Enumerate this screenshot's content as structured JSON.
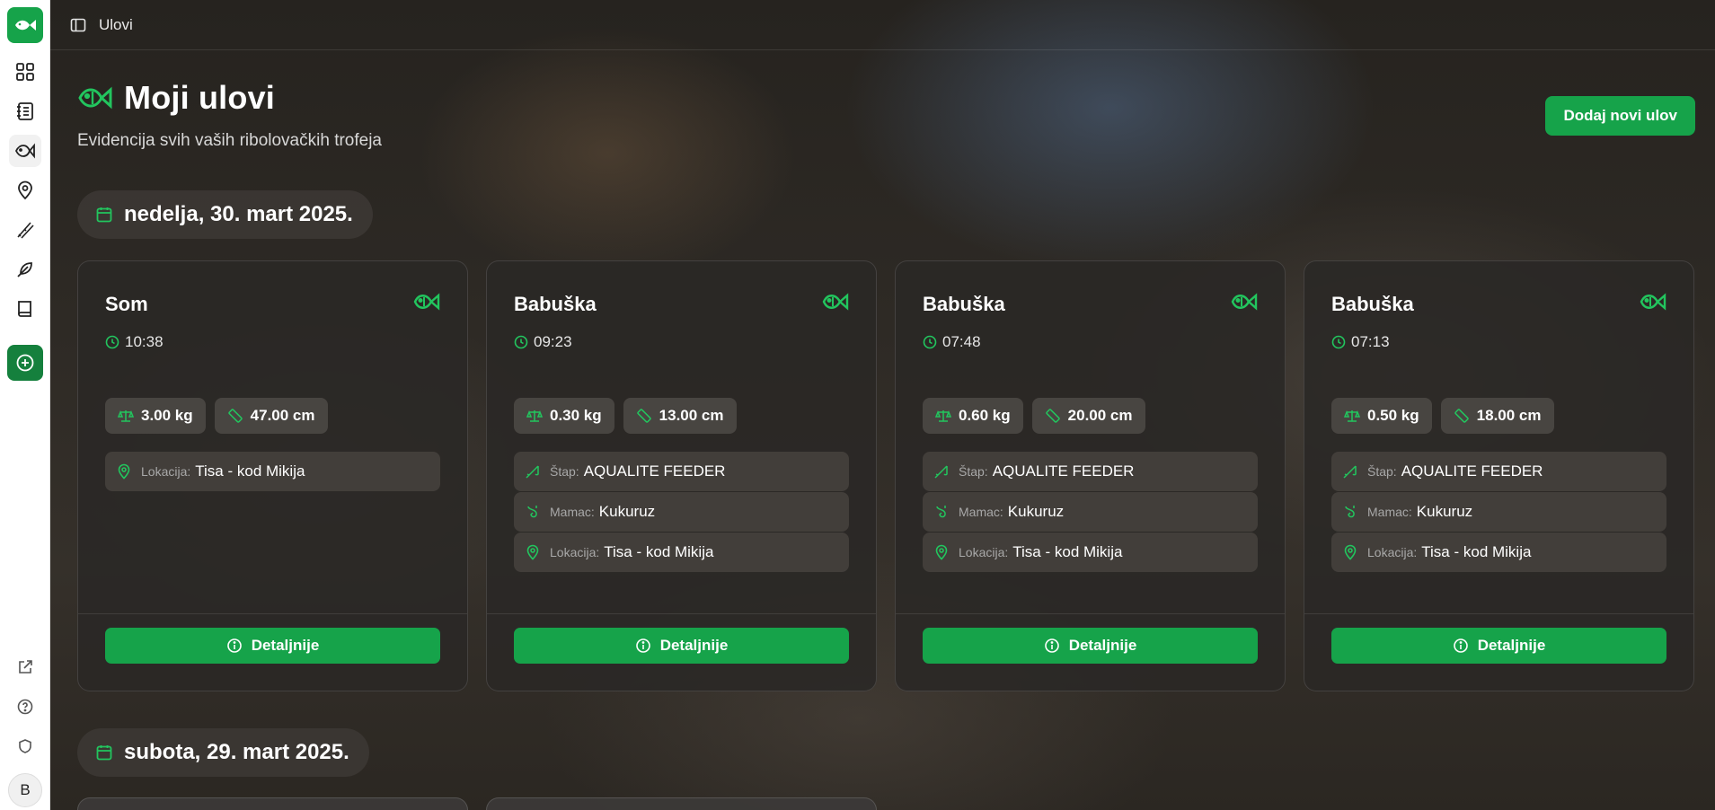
{
  "app": {
    "title": "Ulovi"
  },
  "sidebar": {
    "items": [
      {
        "name": "dashboard",
        "icon": "grid-icon"
      },
      {
        "name": "journal",
        "icon": "notebook-icon"
      },
      {
        "name": "catches",
        "icon": "fish-icon",
        "active": true
      },
      {
        "name": "locations",
        "icon": "map-pin-icon"
      },
      {
        "name": "rods",
        "icon": "fishing-rods-icon"
      },
      {
        "name": "baits",
        "icon": "feather-icon"
      },
      {
        "name": "guide",
        "icon": "book-icon"
      }
    ],
    "add_icon": "plus-circle-icon",
    "bottom": [
      {
        "name": "external",
        "icon": "external-link-icon"
      },
      {
        "name": "help",
        "icon": "help-circle-icon"
      },
      {
        "name": "privacy",
        "icon": "shield-icon"
      }
    ],
    "avatar_initial": "B"
  },
  "header": {
    "page_title": "Moji ulovi",
    "subtitle": "Evidencija svih vaših ribolovačkih trofeja",
    "add_button": "Dodaj novi ulov"
  },
  "groups": [
    {
      "date": "nedelja, 30. mart 2025.",
      "catches": [
        {
          "fish": "Som",
          "time": "10:38",
          "weight": "3.00 kg",
          "length": "47.00 cm",
          "rod": null,
          "bait": null,
          "location": "Tisa - kod Mikija"
        },
        {
          "fish": "Babuška",
          "time": "09:23",
          "weight": "0.30 kg",
          "length": "13.00 cm",
          "rod": "AQUALITE FEEDER",
          "bait": "Kukuruz",
          "location": "Tisa - kod Mikija"
        },
        {
          "fish": "Babuška",
          "time": "07:48",
          "weight": "0.60 kg",
          "length": "20.00 cm",
          "rod": "AQUALITE FEEDER",
          "bait": "Kukuruz",
          "location": "Tisa - kod Mikija"
        },
        {
          "fish": "Babuška",
          "time": "07:13",
          "weight": "0.50 kg",
          "length": "18.00 cm",
          "rod": "AQUALITE FEEDER",
          "bait": "Kukuruz",
          "location": "Tisa - kod Mikija"
        }
      ]
    },
    {
      "date": "subota, 29. mart 2025."
    }
  ],
  "labels": {
    "rod": "Štap:",
    "bait": "Mamac:",
    "location": "Lokacija:",
    "details_button": "Detaljnije"
  },
  "colors": {
    "accent": "#16a34a",
    "accent_icon": "#22c55e"
  }
}
